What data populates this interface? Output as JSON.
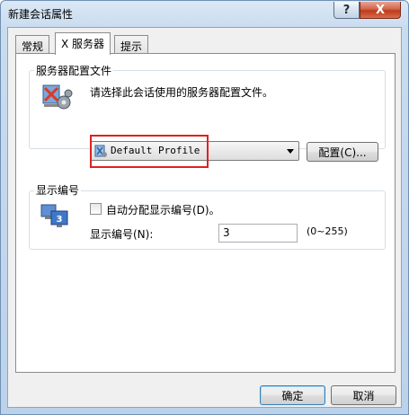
{
  "window": {
    "title": "新建会话属性",
    "help_label": "?",
    "close_label": "X"
  },
  "tabs": [
    {
      "label": "常规",
      "active": false
    },
    {
      "label": "X 服务器",
      "active": true
    },
    {
      "label": "提示",
      "active": false
    }
  ],
  "profile_group": {
    "legend": "服务器配置文件",
    "description": "请选择此会话使用的服务器配置文件。",
    "selected_profile": "Default Profile",
    "configure_button": "配置(C)..."
  },
  "display_group": {
    "legend": "显示编号",
    "auto_assign_label": "自动分配显示编号(D)。",
    "auto_assign_checked": false,
    "display_number_label": "显示编号(N):",
    "display_number_value": "3",
    "range_hint": "(0~255)",
    "monitor_number": "3"
  },
  "footer": {
    "ok_label": "确定",
    "cancel_label": "取消"
  },
  "colors": {
    "highlight_box": "#e02020",
    "close_button": "#c0391b"
  }
}
